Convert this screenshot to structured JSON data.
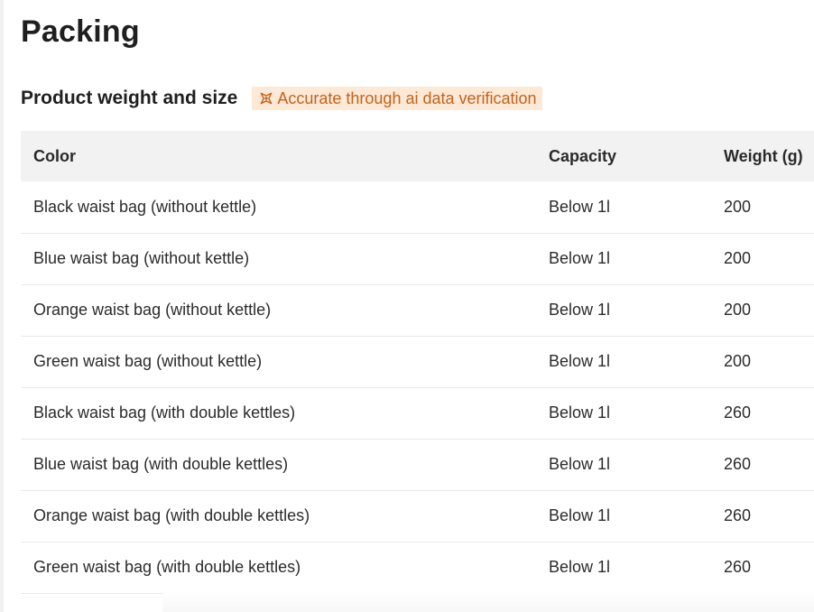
{
  "page": {
    "title": "Packing"
  },
  "section": {
    "title": "Product weight and size",
    "badge": {
      "icon": "ai-sparkle-icon",
      "label": "Accurate through ai data verification",
      "color": "#c2631c",
      "background": "#fde9d6"
    }
  },
  "table": {
    "headers": [
      "Color",
      "Capacity",
      "Weight (g)"
    ],
    "rows": [
      [
        "Black waist bag (without kettle)",
        "Below 1l",
        "200"
      ],
      [
        "Blue waist bag (without kettle)",
        "Below 1l",
        "200"
      ],
      [
        "Orange waist bag (without kettle)",
        "Below 1l",
        "200"
      ],
      [
        "Green waist bag (without kettle)",
        "Below 1l",
        "200"
      ],
      [
        "Black waist bag (with double kettles)",
        "Below 1l",
        "260"
      ],
      [
        "Blue waist bag (with double kettles)",
        "Below 1l",
        "260"
      ],
      [
        "Orange waist bag (with double kettles)",
        "Below 1l",
        "260"
      ],
      [
        "Green waist bag (with double kettles)",
        "Below 1l",
        "260"
      ]
    ]
  }
}
